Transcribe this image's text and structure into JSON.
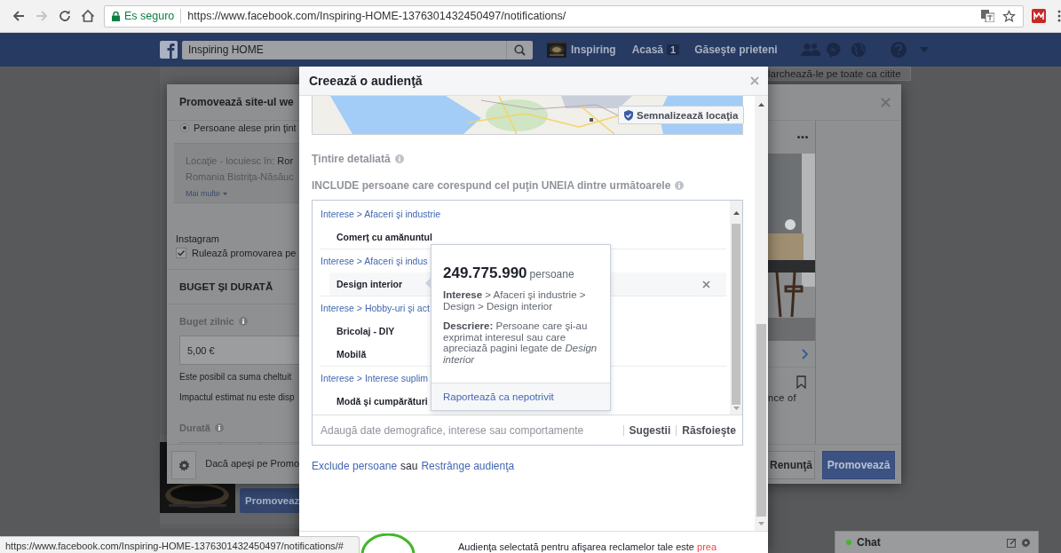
{
  "browser": {
    "secure_label": "Es seguro",
    "url": "https://www.facebook.com/Inspiring-HOME-1376301432450497/notifications/"
  },
  "facebook_bar": {
    "search_value": "Inspiring HOME",
    "profile_name": "Inspiring",
    "nav": [
      {
        "label": "Acasă",
        "count": "1"
      },
      {
        "label": "Găseşte prieteni"
      }
    ]
  },
  "background_page": {
    "mark_all_read": "larchează-le pe toate ca citite",
    "post_button": "Promoveaz"
  },
  "promote_dialog": {
    "title": "Promovează site-ul we",
    "audience_option": {
      "label": "Persoane alese prin ţint",
      "selected": true
    },
    "location": "Locaţie - locuiesc în: **Ror**",
    "location_line2": "Romania Bistriţa-Năsăuc",
    "more_link": "Mai multe",
    "instagram_heading": "Instagram",
    "instagram_option": {
      "label": "Rulează promovarea pe",
      "checked": true
    },
    "budget_heading": "BUGET ŞI DURATĂ",
    "daily_budget_label": "Buget zilnic",
    "daily_budget_value": "5,00 €",
    "notes": [
      "Este posibil ca suma cheltuit",
      "Impactul estimat nu este disp"
    ],
    "duration_label": "Durată",
    "footer_text": "Dacă apeşi pe Promo",
    "preview_caption": "nce of",
    "buttons": [
      {
        "label": "Renunţă",
        "kind": "secondary"
      },
      {
        "label": "Promovează",
        "kind": "primary"
      }
    ]
  },
  "audience_modal": {
    "title": "Creează o audienţă",
    "locate_button": "Semnalizează locaţia",
    "detailed_targeting_label": "Ţintire detaliată",
    "include_label": "INCLUDE persoane care corespund cel puţin UNEIA dintre următoarele",
    "groups": [
      {
        "path": "Interese > Afaceri şi industrie",
        "items": [
          {
            "label": "Comerţ cu amănuntul",
            "selected": false
          }
        ]
      },
      {
        "path": "Interese > Afaceri şi indus",
        "items": [
          {
            "label": "Design interior",
            "selected": true
          }
        ]
      },
      {
        "path": "Interese > Hobby-uri şi act",
        "items": [
          {
            "label": "Bricolaj - DIY",
            "selected": false
          },
          {
            "label": "Mobilă",
            "selected": false
          }
        ]
      },
      {
        "path": "Interese > Interese suplim",
        "items": [
          {
            "label": "Modă şi cumpărături",
            "selected": false
          }
        ]
      }
    ],
    "tooltip": {
      "count": "249.775.990",
      "unit": "persoane",
      "path": "**Interese** > Afaceri şi industrie > Design > Design interior",
      "description": "**Descriere:** Persoane care şi-au exprimat interesul sau care apreciază pagini legate de *Design interior*",
      "report_link": "Raportează ca nepotrivit"
    },
    "search_placeholder": "Adaugă date demografice, interese sau comportamente",
    "search_actions": [
      "Sugestii",
      "Răsfoieşte"
    ],
    "exclude_link": "Exclude persoane",
    "conjunction": "sau",
    "narrow_link": "Restrânge audienţa",
    "audience_summary": "Audienţa selectată pentru afişarea reclamelor tale este **prea**"
  },
  "status_url": "https://www.facebook.com/Inspiring-HOME-1376301432450497/notifications/#",
  "chat": {
    "label": "Chat",
    "online": true
  }
}
